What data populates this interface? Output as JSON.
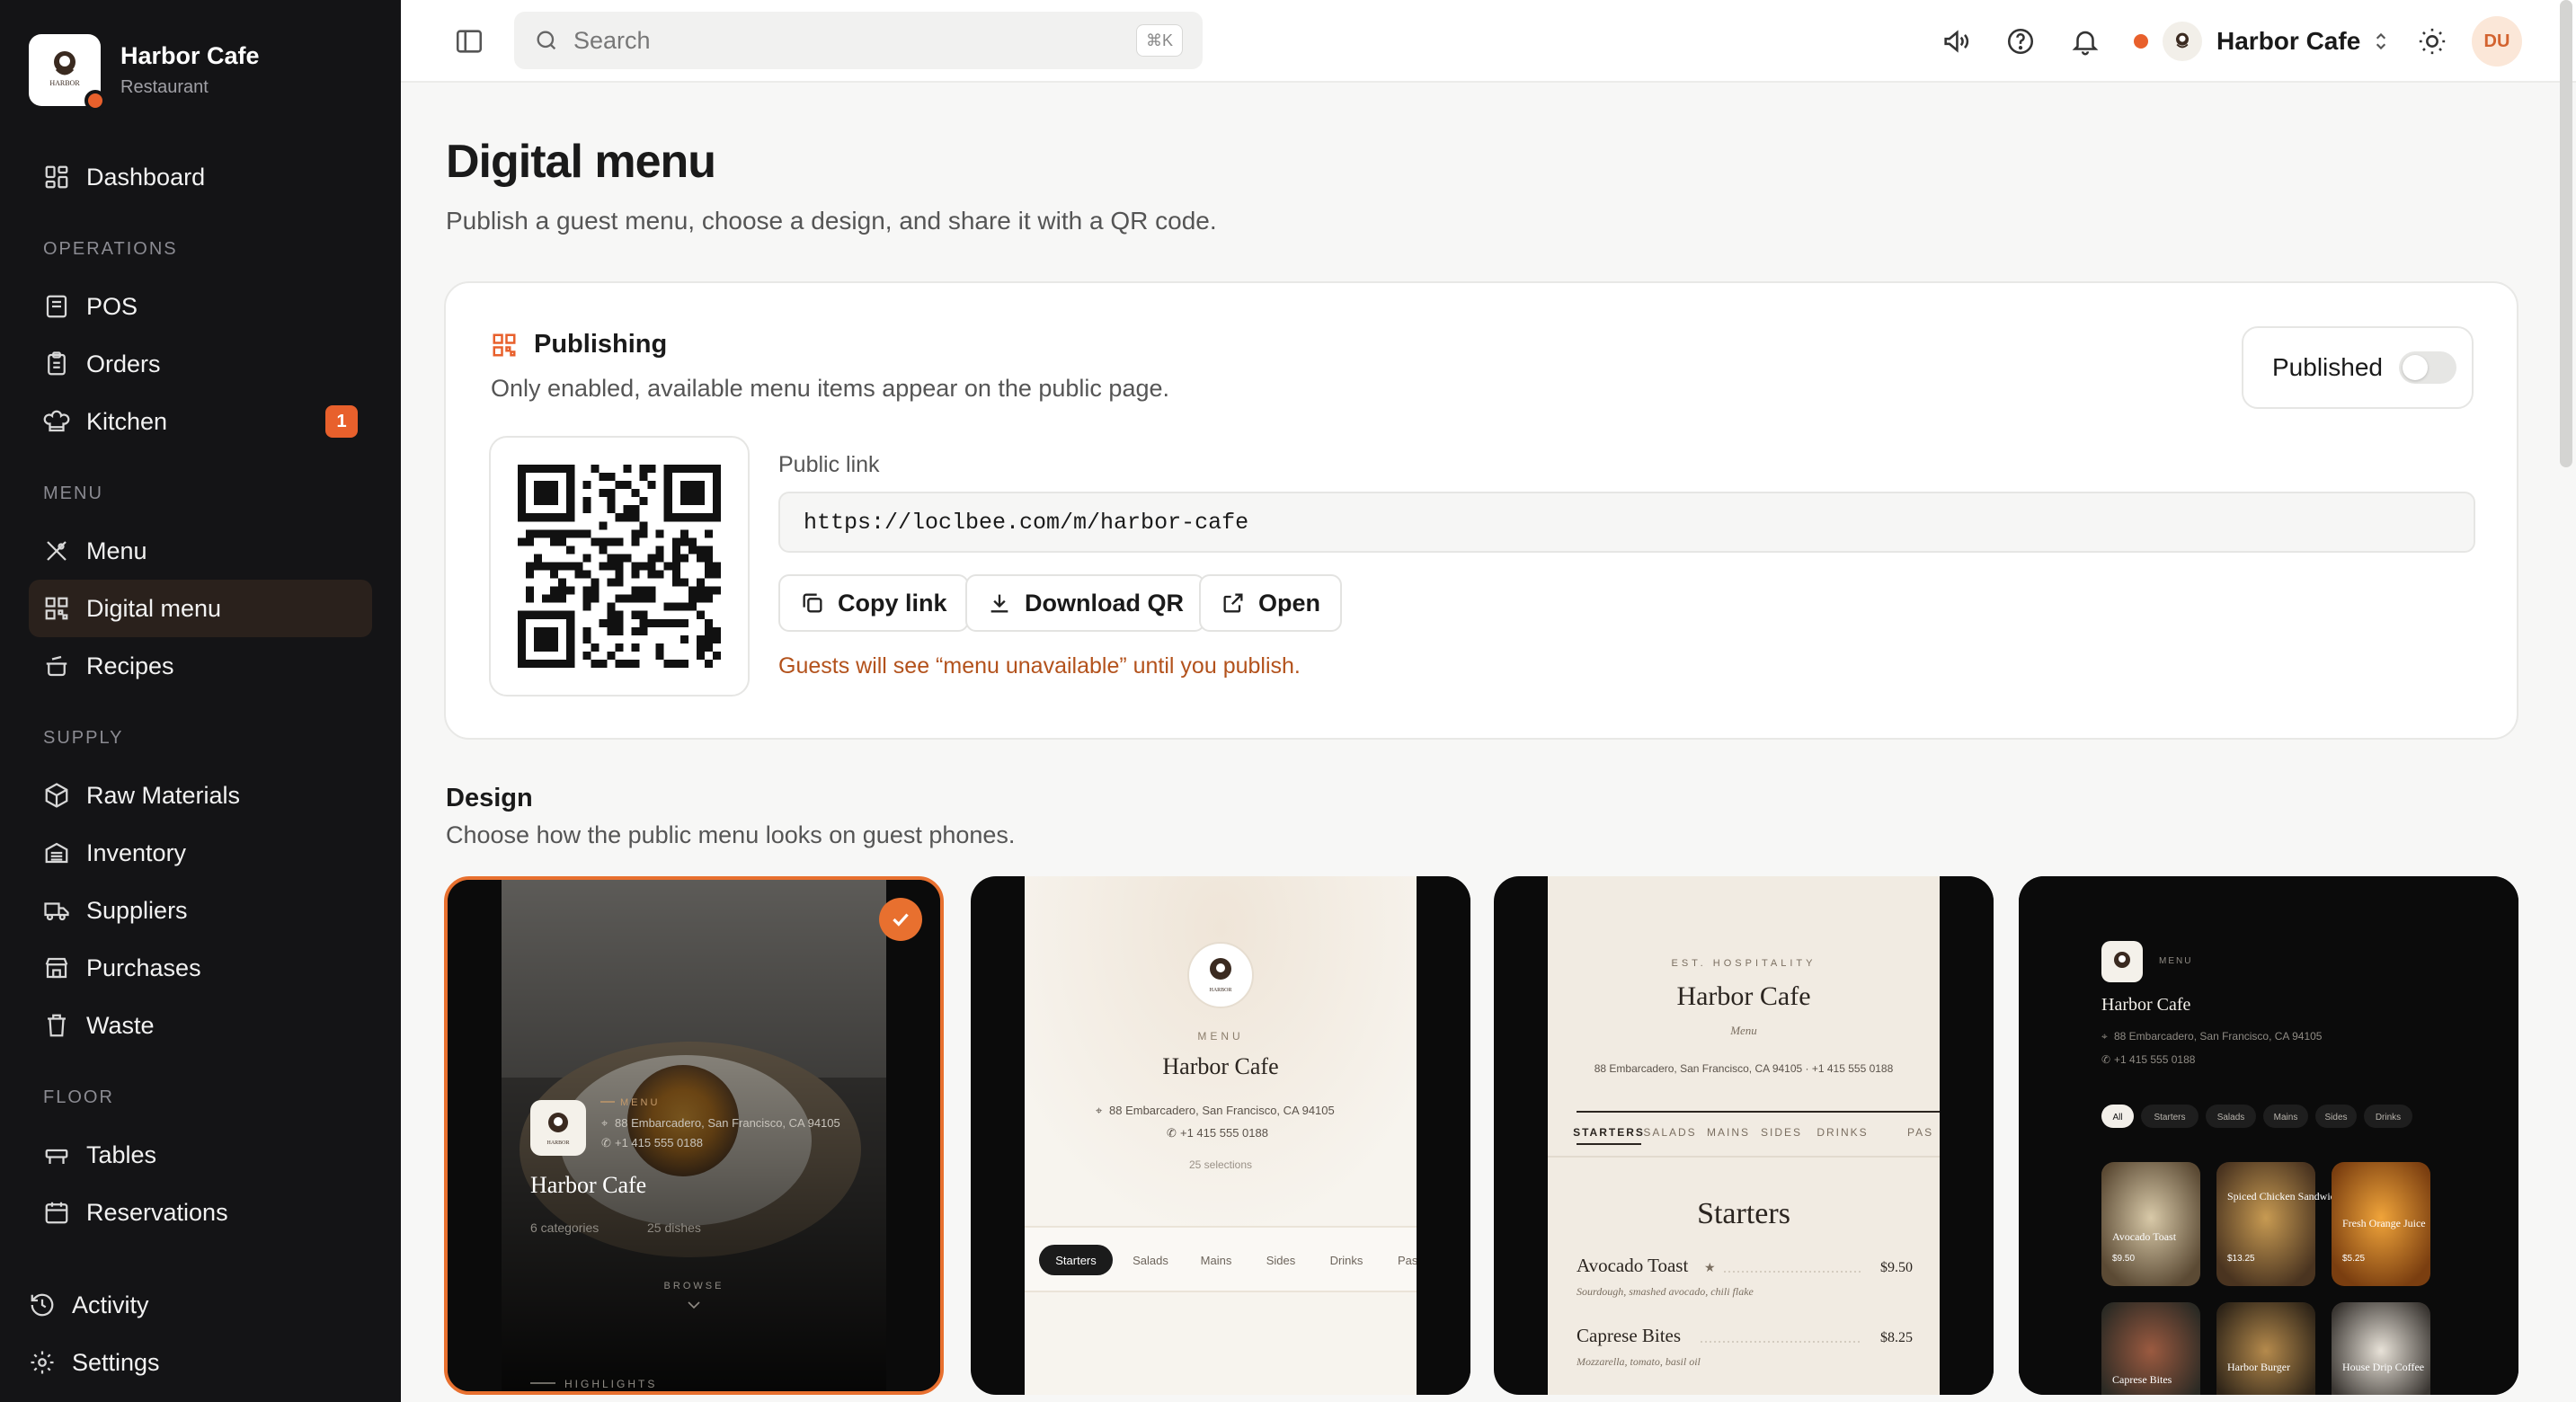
{
  "sidebar": {
    "brand_name": "Harbor Cafe",
    "brand_type": "Restaurant",
    "logo_text": "HARBOR",
    "dashboard": "Dashboard",
    "sections": {
      "operations": "OPERATIONS",
      "menu": "MENU",
      "supply": "SUPPLY",
      "floor": "FLOOR"
    },
    "items": {
      "pos": "POS",
      "orders": "Orders",
      "kitchen": "Kitchen",
      "kitchen_badge": "1",
      "menu": "Menu",
      "digital_menu": "Digital menu",
      "recipes": "Recipes",
      "raw_materials": "Raw Materials",
      "inventory": "Inventory",
      "suppliers": "Suppliers",
      "purchases": "Purchases",
      "waste": "Waste",
      "tables": "Tables",
      "reservations": "Reservations"
    },
    "activity": "Activity",
    "settings": "Settings"
  },
  "topbar": {
    "search_placeholder": "Search",
    "search_shortcut": "⌘K",
    "restaurant": "Harbor Cafe",
    "avatar_initials": "DU"
  },
  "page": {
    "title": "Digital menu",
    "subtitle": "Publish a guest menu, choose a design, and share it with a QR code."
  },
  "publishing": {
    "title": "Publishing",
    "description": "Only enabled, available menu items appear on the public page.",
    "toggle_label": "Published",
    "published": false,
    "link_label": "Public link",
    "link_value": "https://loclbee.com/m/harbor-cafe",
    "copy_label": "Copy link",
    "download_label": "Download QR",
    "open_label": "Open",
    "warning": "Guests will see “menu unavailable” until you publish."
  },
  "design": {
    "title": "Design",
    "subtitle": "Choose how the public menu looks on guest phones.",
    "restaurant_name": "Harbor Cafe",
    "address": "88 Embarcadero, San Francisco, CA 94105",
    "phone": "+1 415 555 0188",
    "address_phone": "88 Embarcadero, San Francisco, CA 94105 · +1 415 555 0188",
    "theme1": {
      "menu_label": "MENU",
      "categories": "6 categories",
      "dishes": "25 dishes",
      "browse": "BROWSE",
      "highlights": "HIGHLIGHTS"
    },
    "theme2": {
      "menu_label": "MENU",
      "selections": "25 selections",
      "tabs": [
        "Starters",
        "Salads",
        "Mains",
        "Sides",
        "Drinks",
        "Pas"
      ]
    },
    "theme3": {
      "eyebrow": "EST. HOSPITALITY",
      "menu_label": "Menu",
      "tabs": [
        "STARTERS",
        "SALADS",
        "MAINS",
        "SIDES",
        "DRINKS",
        "PAS"
      ],
      "section": "Starters",
      "items": [
        {
          "name": "Avocado Toast",
          "star": "★",
          "price": "$9.50",
          "desc": "Sourdough, smashed avocado, chili flake"
        },
        {
          "name": "Caprese Bites",
          "star": "",
          "price": "$8.25",
          "desc": "Mozzarella, tomato, basil oil"
        }
      ]
    },
    "theme4": {
      "menu_label": "MENU",
      "chips": [
        "All",
        "Starters",
        "Salads",
        "Mains",
        "Sides",
        "Drinks"
      ],
      "tiles": [
        {
          "name": "Avocado Toast",
          "price": "$9.50"
        },
        {
          "name": "Spiced Chicken Sandwich",
          "price": "$13.25"
        },
        {
          "name": "Fresh Orange Juice",
          "price": "$5.25"
        },
        {
          "name": "Caprese Bites",
          "price": ""
        },
        {
          "name": "Harbor Burger",
          "price": ""
        },
        {
          "name": "House Drip Coffee",
          "price": ""
        }
      ]
    }
  },
  "colors": {
    "accent": "#e8602c",
    "sidebar_bg": "#141416",
    "warning_text": "#b3521c"
  }
}
